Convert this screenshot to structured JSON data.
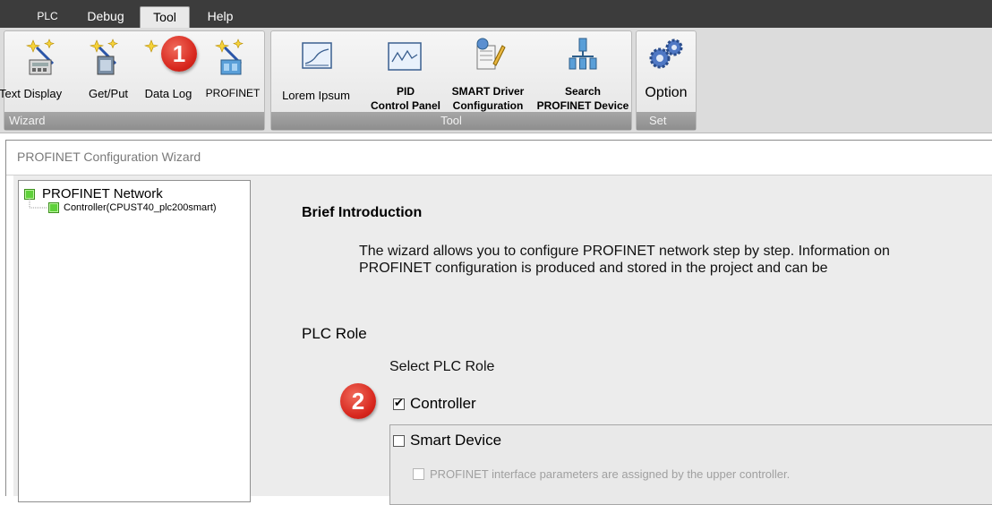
{
  "menu": {
    "tabs": [
      {
        "label": "PLC"
      },
      {
        "label": "Debug"
      },
      {
        "label": "Tool"
      },
      {
        "label": "Help"
      }
    ],
    "active": "Tool"
  },
  "ribbon": {
    "wizard_group": {
      "footer": "Wizard",
      "items": [
        {
          "label": "Text Display"
        },
        {
          "label": "Get/Put"
        },
        {
          "label": "Data Log"
        },
        {
          "label": "PROFINET"
        }
      ]
    },
    "tool_group": {
      "footer": "Tool",
      "items": [
        {
          "label": "Lorem Ipsum"
        },
        {
          "label_line1": "PID",
          "label_line2": "Control Panel"
        },
        {
          "label_line1": "SMART Driver",
          "label_line2": "Configuration"
        },
        {
          "label_line1": "Search",
          "label_line2": "PROFINET Device"
        }
      ]
    },
    "set_group": {
      "footer": "Set",
      "items": [
        {
          "label": "Option"
        }
      ]
    }
  },
  "callouts": [
    "1",
    "2"
  ],
  "wizard": {
    "title": "PROFINET Configuration Wizard",
    "tree": {
      "root": "PROFINET Network",
      "child": "Controller(CPUST40_plc200smart)"
    },
    "brief_heading": "Brief Introduction",
    "brief_line1": "The wizard allows you to configure PROFINET network step by step. Information on",
    "brief_line2": "PROFINET configuration is produced and stored in the project and can be",
    "role_heading": "PLC Role",
    "select_label": "Select PLC Role",
    "controller_label": "Controller",
    "controller_checked": true,
    "smart_device_label": "Smart Device",
    "smart_device_checked": false,
    "upper_controller_label": "PROFINET interface parameters are assigned by the upper controller."
  },
  "colors": {
    "menubar": "#3c3c3c",
    "callout": "#d7261d",
    "node_green": "#5fd13a"
  }
}
